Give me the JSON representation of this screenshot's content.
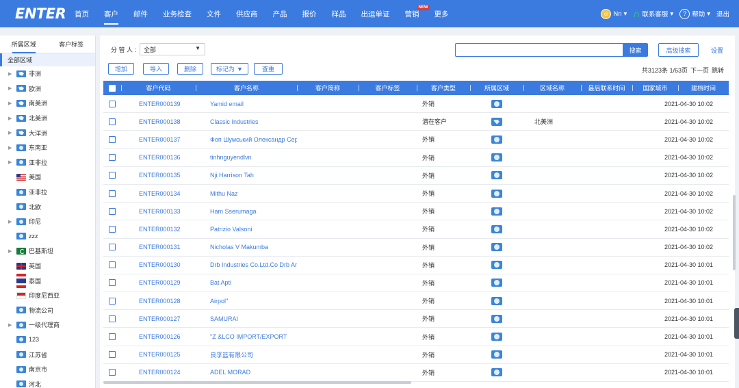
{
  "logo": "ENTER",
  "nav": [
    {
      "label": "首页",
      "active": false
    },
    {
      "label": "客户",
      "active": true
    },
    {
      "label": "邮件",
      "active": false
    },
    {
      "label": "业务检查",
      "active": false
    },
    {
      "label": "文件",
      "active": false
    },
    {
      "label": "供应商",
      "active": false
    },
    {
      "label": "产品",
      "active": false
    },
    {
      "label": "报价",
      "active": false
    },
    {
      "label": "样品",
      "active": false
    },
    {
      "label": "出运单证",
      "active": false
    },
    {
      "label": "营销",
      "active": false,
      "badge": "NEW"
    },
    {
      "label": "更多",
      "active": false
    }
  ],
  "user": {
    "name": "Nn",
    "support": "联系客服",
    "help": "帮助",
    "logout": "退出"
  },
  "sidebar": {
    "tabs": [
      "所属区域",
      "客户标签"
    ],
    "all": "全部区域",
    "items": [
      {
        "label": "非洲",
        "icon": "map",
        "expandable": true
      },
      {
        "label": "欧洲",
        "icon": "map",
        "expandable": true
      },
      {
        "label": "南美洲",
        "icon": "map",
        "expandable": true
      },
      {
        "label": "北美洲",
        "icon": "map",
        "expandable": true
      },
      {
        "label": "大洋洲",
        "icon": "map",
        "expandable": true
      },
      {
        "label": "东南亚",
        "icon": "globe",
        "expandable": true
      },
      {
        "label": "亚非拉",
        "icon": "globe",
        "expandable": true
      },
      {
        "label": "美国",
        "icon": "us",
        "expandable": false
      },
      {
        "label": "亚非拉",
        "icon": "globe",
        "expandable": false
      },
      {
        "label": "北欧",
        "icon": "globe",
        "expandable": false
      },
      {
        "label": "印尼",
        "icon": "globe",
        "expandable": true
      },
      {
        "label": "zzz",
        "icon": "globe",
        "expandable": false
      },
      {
        "label": "巴基斯坦",
        "icon": "pk",
        "expandable": true
      },
      {
        "label": "英国",
        "icon": "uk",
        "expandable": false
      },
      {
        "label": "泰国",
        "icon": "th",
        "expandable": false
      },
      {
        "label": "印度尼西亚",
        "icon": "id",
        "expandable": false
      },
      {
        "label": "物流公司",
        "icon": "globe",
        "expandable": false
      },
      {
        "label": "一级代理商",
        "icon": "globe",
        "expandable": true
      },
      {
        "label": "123",
        "icon": "globe",
        "expandable": false
      },
      {
        "label": "江苏省",
        "icon": "globe",
        "expandable": false
      },
      {
        "label": "南京市",
        "icon": "globe",
        "expandable": false
      },
      {
        "label": "河北",
        "icon": "globe",
        "expandable": false
      }
    ]
  },
  "filter": {
    "label": "分 管 人 :",
    "value": "全部",
    "search_placeholder": "",
    "search_btn": "搜索",
    "advanced_btn": "高级搜索",
    "settings": "设置"
  },
  "actions": {
    "add": "增加",
    "import": "导入",
    "delete": "删除",
    "mark": "标记为",
    "dedupe": "查重"
  },
  "pager": {
    "summary": "共3123条 1/63页",
    "next": "下一页",
    "jump": "跳转"
  },
  "table": {
    "columns": [
      "客户代码",
      "客户名称",
      "客户简称",
      "客户标签",
      "客户类型",
      "所属区域",
      "区域名称",
      "最后联系时间",
      "国家城市",
      "建档时间"
    ],
    "rows": [
      {
        "code": "ENTER000139",
        "name": "Yamid email",
        "type": "外销",
        "region_icon": "globe",
        "region_name": "",
        "created": "2021-04-30 10:02"
      },
      {
        "code": "ENTER000138",
        "name": "Classic Industries",
        "type": "潜在客户",
        "region_icon": "map",
        "region_name": "北美洲",
        "created": "2021-04-30 10:02"
      },
      {
        "code": "ENTER000137",
        "name": "Фоп Шумський Олександр Серг",
        "type": "外销",
        "region_icon": "globe",
        "region_name": "",
        "created": "2021-04-30 10:02"
      },
      {
        "code": "ENTER000136",
        "name": "tinhnguyendlvn",
        "type": "外销",
        "region_icon": "globe",
        "region_name": "",
        "created": "2021-04-30 10:02"
      },
      {
        "code": "ENTER000135",
        "name": "Nji Harrison Tah",
        "type": "外销",
        "region_icon": "globe",
        "region_name": "",
        "created": "2021-04-30 10:02"
      },
      {
        "code": "ENTER000134",
        "name": "Mithu Naz",
        "type": "外销",
        "region_icon": "globe",
        "region_name": "",
        "created": "2021-04-30 10:02"
      },
      {
        "code": "ENTER000133",
        "name": "Ham Sserumaga",
        "type": "外销",
        "region_icon": "globe",
        "region_name": "",
        "created": "2021-04-30 10:02"
      },
      {
        "code": "ENTER000132",
        "name": "Patrizio Valsoni",
        "type": "外销",
        "region_icon": "globe",
        "region_name": "",
        "created": "2021-04-30 10:02"
      },
      {
        "code": "ENTER000131",
        "name": "Nicholas V Makumba",
        "type": "外销",
        "region_icon": "globe",
        "region_name": "",
        "created": "2021-04-30 10:02"
      },
      {
        "code": "ENTER000130",
        "name": "Drb Industries Co.Ltd.Co Drb Am",
        "type": "外销",
        "region_icon": "globe",
        "region_name": "",
        "created": "2021-04-30 10:01"
      },
      {
        "code": "ENTER000129",
        "name": "Bat Apti",
        "type": "外销",
        "region_icon": "globe",
        "region_name": "",
        "created": "2021-04-30 10:01"
      },
      {
        "code": "ENTER000128",
        "name": "Airpol\"",
        "type": "外销",
        "region_icon": "globe",
        "region_name": "",
        "created": "2021-04-30 10:01"
      },
      {
        "code": "ENTER000127",
        "name": "SAMURAI",
        "type": "外销",
        "region_icon": "globe",
        "region_name": "",
        "created": "2021-04-30 10:01"
      },
      {
        "code": "ENTER000126",
        "name": "\"Z &LCO IMPORT/EXPORT",
        "type": "外销",
        "region_icon": "globe",
        "region_name": "",
        "created": "2021-04-30 10:01"
      },
      {
        "code": "ENTER000125",
        "name": "良孚篮有限公司",
        "type": "外销",
        "region_icon": "globe",
        "region_name": "",
        "created": "2021-04-30 10:01"
      },
      {
        "code": "ENTER000124",
        "name": "ADEL MORAD",
        "type": "外销",
        "region_icon": "globe",
        "region_name": "",
        "created": "2021-04-30 10:01"
      }
    ]
  },
  "colors": {
    "primary": "#3b7be0",
    "badge": "#e8352b",
    "support_icon": "#3fd07a"
  }
}
